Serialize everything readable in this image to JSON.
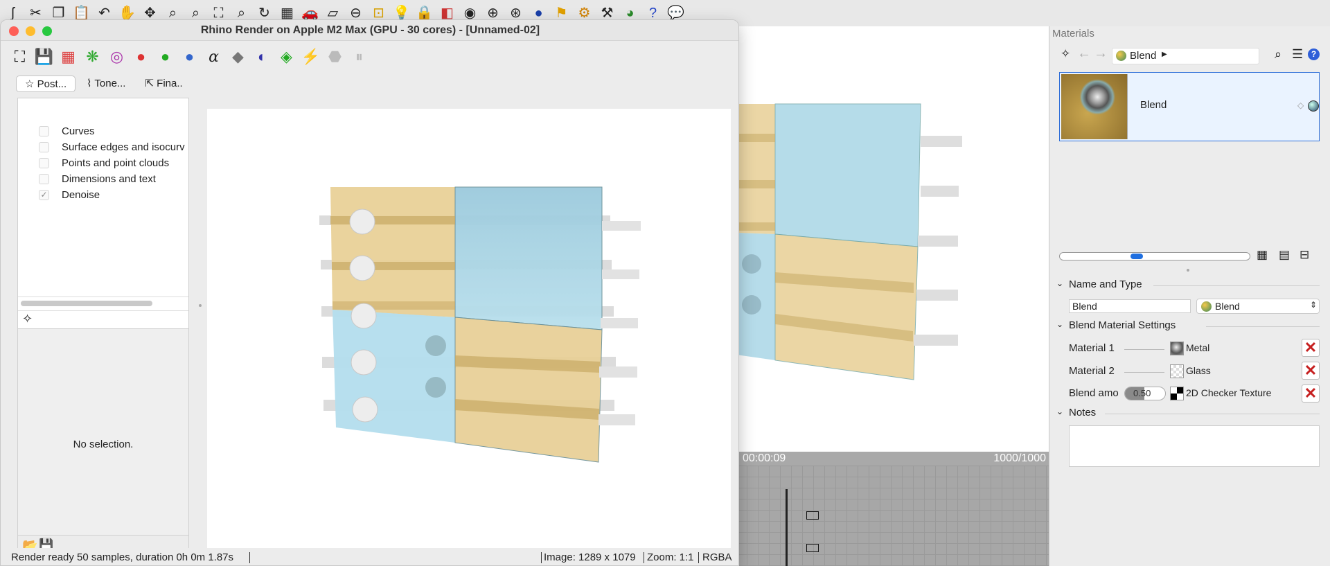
{
  "render_window": {
    "title": "Rhino Render on Apple M2 Max (GPU - 30 cores) - [Unnamed-02]",
    "tabs": [
      "Post...",
      "Tone...",
      "Fina.."
    ],
    "options": [
      {
        "label": "Curves",
        "checked": false
      },
      {
        "label": "Surface edges and isocurv",
        "checked": false
      },
      {
        "label": "Points and point clouds",
        "checked": false
      },
      {
        "label": "Dimensions and text",
        "checked": false
      },
      {
        "label": "Denoise",
        "checked": true
      }
    ],
    "no_selection": "No selection.",
    "status": {
      "message": "Render ready 50 samples, duration 0h 0m 1.87s",
      "image": "Image: 1289 x 1079",
      "zoom": "Zoom: 1:1",
      "mode": "RGBA"
    }
  },
  "viewport": {
    "time": "00:00:09",
    "progress": "1000/1000"
  },
  "materials": {
    "panel_title": "Materials",
    "breadcrumb": "Blend",
    "item_name": "Blend",
    "slider_fraction": 0.4,
    "sections": {
      "name_and_type": "Name and Type",
      "settings": "Blend Material Settings",
      "notes": "Notes"
    },
    "name_value": "Blend",
    "type_value": "Blend",
    "rows": [
      {
        "label": "Material 1",
        "value": "Metal"
      },
      {
        "label": "Material 2",
        "value": "Glass"
      },
      {
        "label": "Blend amo",
        "value": "2D Checker Texture"
      }
    ],
    "blend_amount": "0.50",
    "colors": {
      "accent": "#1f6fe0",
      "panel_wood": "#e8cf95",
      "panel_glass": "#a9d6e6",
      "delete_red": "#c62020"
    }
  }
}
